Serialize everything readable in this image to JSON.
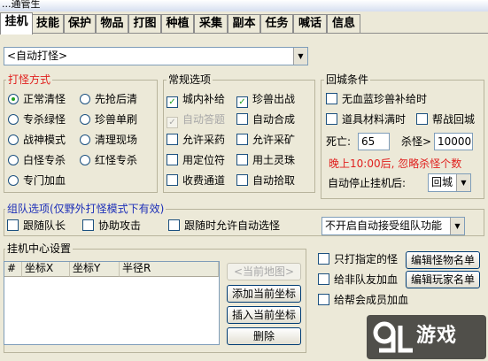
{
  "window": {
    "title": "...通管生"
  },
  "tabs": [
    "挂机",
    "技能",
    "保护",
    "物品",
    "打图",
    "种植",
    "采集",
    "副本",
    "任务",
    "喊话",
    "信息"
  ],
  "mode_select": {
    "value": "<自动打怪>"
  },
  "attack_mode": {
    "title": "打怪方式",
    "options": [
      {
        "label": "正常清怪",
        "selected": true
      },
      {
        "label": "先抢后清",
        "selected": false
      },
      {
        "label": "专杀绿怪",
        "selected": false
      },
      {
        "label": "珍兽单刷",
        "selected": false
      },
      {
        "label": "战神模式",
        "selected": false
      },
      {
        "label": "清理现场",
        "selected": false
      },
      {
        "label": "白怪专杀",
        "selected": false
      },
      {
        "label": "红怪专杀",
        "selected": false
      },
      {
        "label": "专门加血",
        "selected": false
      }
    ]
  },
  "general": {
    "title": "常规选项",
    "options": [
      {
        "label": "城内补给",
        "checked": true,
        "disabled": false
      },
      {
        "label": "珍兽出战",
        "checked": true,
        "disabled": false
      },
      {
        "label": "自动答题",
        "checked": true,
        "disabled": true
      },
      {
        "label": "自动合成",
        "checked": false,
        "disabled": false
      },
      {
        "label": "允许采药",
        "checked": false,
        "disabled": false
      },
      {
        "label": "允许采矿",
        "checked": false,
        "disabled": false
      },
      {
        "label": "用定位符",
        "checked": false,
        "disabled": false
      },
      {
        "label": "用土灵珠",
        "checked": false,
        "disabled": false
      },
      {
        "label": "收费通道",
        "checked": false,
        "disabled": false
      },
      {
        "label": "自动拾取",
        "checked": false,
        "disabled": false
      }
    ]
  },
  "return_city": {
    "title": "回城条件",
    "no_hp_mp": "无血蓝珍兽补给时",
    "items_full": "道具材料满时",
    "help_return": "帮战回城",
    "death_label": "死亡:",
    "death_value": "65",
    "kill_label": "杀怪>",
    "kill_value": "10000",
    "night_note": "晚上10:00后, 忽略杀怪个数",
    "auto_stop_label": "自动停止挂机后:",
    "auto_stop_value": "回城"
  },
  "team": {
    "title": "组队选项(仅野外打怪模式下有效)",
    "follow_leader": "跟随队长",
    "assist_attack": "协助攻击",
    "follow_auto_select": "跟随时允许自动选怪",
    "accept_invite": "不开启自动接受组队功能"
  },
  "center": {
    "title": "挂机中心设置",
    "columns": [
      "#",
      "坐标X",
      "坐标Y",
      "半径R"
    ],
    "current_map_btn": "<当前地图>",
    "add_btn": "添加当前坐标",
    "insert_btn": "插入当前坐标",
    "delete_btn": "删除"
  },
  "specific": {
    "only_attack": "只打指定的怪",
    "edit_monster": "编辑怪物名单",
    "heal_party": "给非队友加血",
    "edit_player": "编辑玩家名单",
    "heal_guild": "给帮会成员加血"
  },
  "watermark": {
    "text": "游戏",
    "mark": "9L"
  }
}
